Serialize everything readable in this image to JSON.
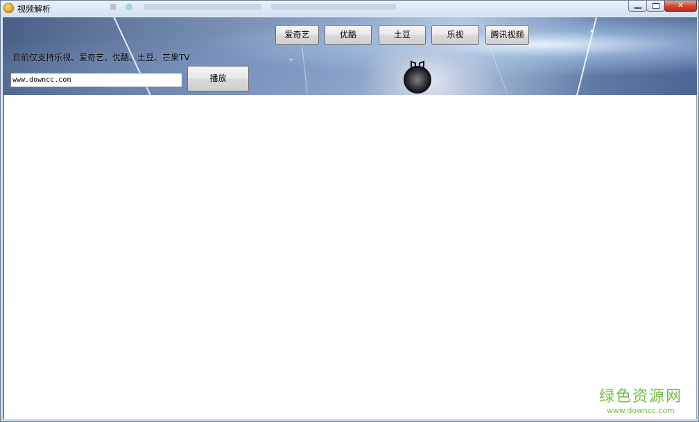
{
  "window": {
    "title": "视频解析",
    "minimize_label": "",
    "maximize_label": "",
    "close_label": "✕"
  },
  "site_buttons": [
    {
      "label": "爱奇艺"
    },
    {
      "label": "优酷"
    },
    {
      "label": "土豆"
    },
    {
      "label": "乐视"
    },
    {
      "label": "腾讯视频"
    }
  ],
  "support_text": "目前仅支持乐视、爱奇艺、优酷、土豆、芒果TV",
  "url_input": {
    "value": "www.downcc.com"
  },
  "play_button": {
    "label": "播放"
  },
  "watermark": {
    "main": "绿色资源网",
    "sub": "www.downcc.com"
  },
  "colors": {
    "watermark": "#6cbf3f",
    "close_button": "#c9462c",
    "content_bg": "#ffffff"
  }
}
